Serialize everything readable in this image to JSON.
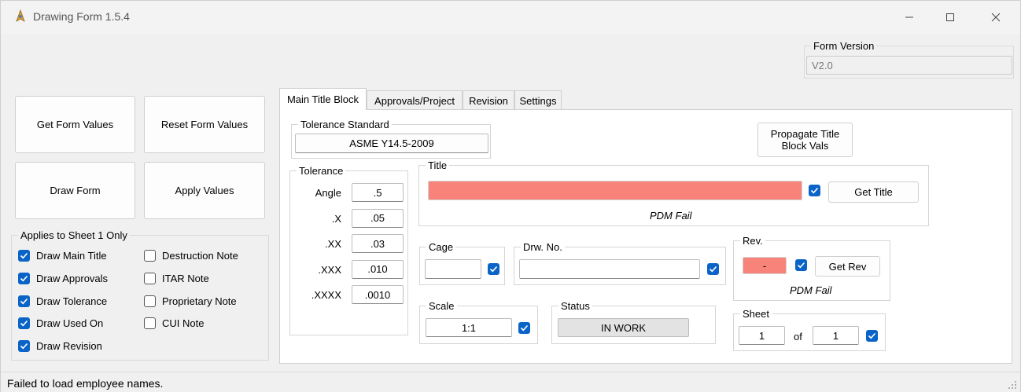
{
  "window": {
    "title": "Drawing Form 1.5.4"
  },
  "form_version": {
    "label": "Form Version",
    "value": "V2.0"
  },
  "buttons": {
    "get_form_values": "Get Form Values",
    "reset_form_values": "Reset Form Values",
    "draw_form": "Draw Form",
    "apply_values": "Apply Values"
  },
  "sheet1": {
    "label": "Applies to Sheet 1 Only",
    "left": [
      {
        "label": "Draw Main Title",
        "checked": true
      },
      {
        "label": "Draw Approvals",
        "checked": true
      },
      {
        "label": "Draw Tolerance",
        "checked": true
      },
      {
        "label": "Draw Used On",
        "checked": true
      },
      {
        "label": "Draw Revision",
        "checked": true
      }
    ],
    "right": [
      {
        "label": "Destruction Note",
        "checked": false
      },
      {
        "label": "ITAR Note",
        "checked": false
      },
      {
        "label": "Proprietary Note",
        "checked": false
      },
      {
        "label": "CUI Note",
        "checked": false
      }
    ]
  },
  "tabs": [
    "Main Title Block",
    "Approvals/Project",
    "Revision",
    "Settings"
  ],
  "tolerance_standard": {
    "label": "Tolerance Standard",
    "value": "ASME Y14.5-2009"
  },
  "propagate_button": {
    "line1": "Propagate Title",
    "line2": "Block Vals"
  },
  "tolerance": {
    "label": "Tolerance",
    "rows": [
      {
        "name": "Angle",
        "value": ".5"
      },
      {
        "name": ".X",
        "value": ".05"
      },
      {
        "name": ".XX",
        "value": ".03"
      },
      {
        "name": ".XXX",
        "value": ".010"
      },
      {
        "name": ".XXXX",
        "value": ".0010"
      }
    ]
  },
  "title": {
    "label": "Title",
    "value": "",
    "checked": true,
    "button": "Get Title",
    "status": "PDM Fail"
  },
  "cage": {
    "label": "Cage",
    "value": "",
    "checked": true
  },
  "drw_no": {
    "label": "Drw. No.",
    "value": "",
    "checked": true
  },
  "rev": {
    "label": "Rev.",
    "value": "-",
    "checked": true,
    "button": "Get Rev",
    "status": "PDM Fail"
  },
  "scale": {
    "label": "Scale",
    "value": "1:1",
    "checked": true
  },
  "status": {
    "label": "Status",
    "value": "IN WORK"
  },
  "sheet": {
    "label": "Sheet",
    "number": "1",
    "of_label": "of",
    "total": "1",
    "checked": true
  },
  "statusbar": {
    "message": "Failed to load employee names."
  },
  "colors": {
    "error_fill": "#f8837a",
    "checkbox_on": "#0a64c8"
  }
}
